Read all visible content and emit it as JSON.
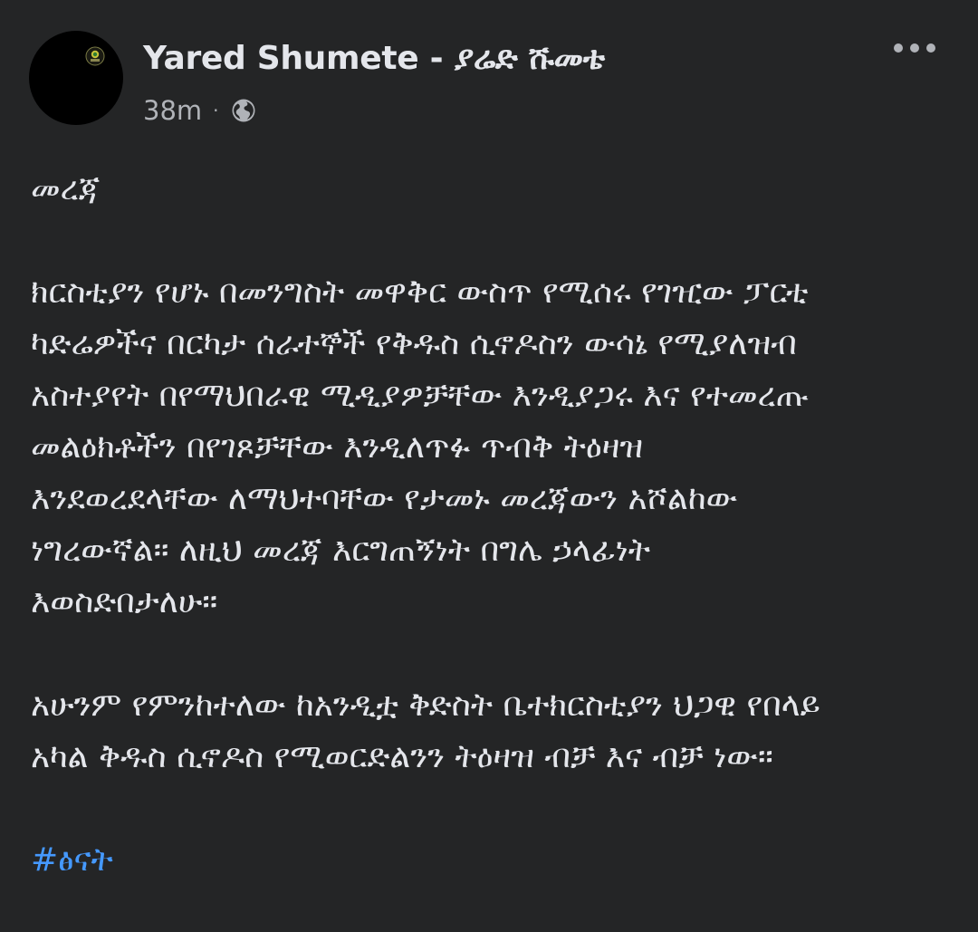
{
  "post": {
    "author": "Yared Shumete - ያሬድ ሹመቴ",
    "timestamp": "38m",
    "separator": "·",
    "privacy_icon": "globe-icon",
    "more_icon": "more-horizontal-icon",
    "title_line": "መረጃ",
    "paragraph1": [
      "ክርስቲያን የሆኑ በመንግስት መዋቅር ውስጥ የሚሰሩ የገዢው ፓርቲ",
      "ካድሬዎችና በርካታ ሰራተኞች የቅዱስ ሲኖዶስን ውሳኔ የሚያለዝብ",
      "አስተያየት በየማህበራዊ ሚዲያዎቻቸው እንዲያጋሩ እና የተመረጡ",
      "መልዕክቶችን በየገጾቻቸው እንዲለጥፉ ጥብቅ ትዕዛዝ",
      "እንደወረደላቸው ለማህተባቸው የታመኑ መረጃውን አሾልከው",
      "ነግረውኛል። ለዚህ መረጃ እርግጠኝነት በግሌ ኃላፊነት",
      "እወስድበታለሁ።"
    ],
    "paragraph2": [
      "አሁንም የምንከተለው ከአንዲቷ ቅድስት ቤተክርስቲያን ህጋዊ የበላይ",
      "አካል ቅዱስ ሲኖዶስ የሚወርድልንን ትዕዛዝ ብቻ እና ብቻ ነው።"
    ],
    "hashtag": "#ፅናት"
  },
  "colors": {
    "background": "#242526",
    "text_primary": "#e4e6eb",
    "text_secondary": "#b0b3b8",
    "link": "#4599ff"
  }
}
